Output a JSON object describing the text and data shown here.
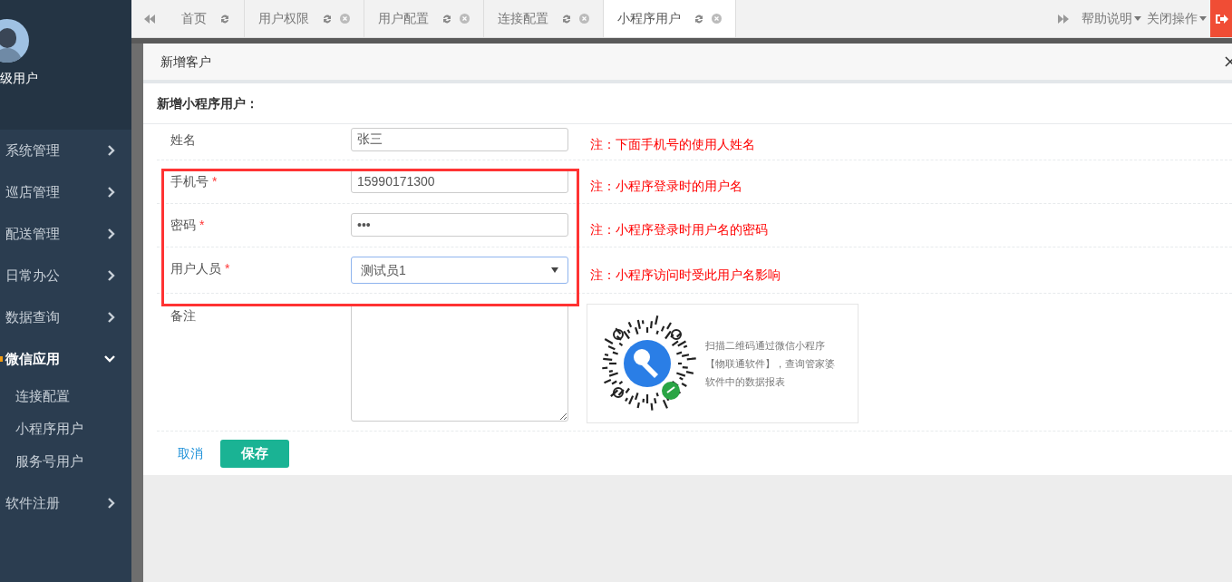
{
  "user": {
    "name": "级用户"
  },
  "sidebar": {
    "items": [
      {
        "label": "系统管理",
        "expanded": false
      },
      {
        "label": "巡店管理",
        "expanded": false
      },
      {
        "label": "配送管理",
        "expanded": false
      },
      {
        "label": "日常办公",
        "expanded": false
      },
      {
        "label": "数据查询",
        "expanded": false
      },
      {
        "label": "微信应用",
        "expanded": true,
        "children": [
          {
            "label": "连接配置"
          },
          {
            "label": "小程序用户"
          },
          {
            "label": "服务号用户"
          }
        ]
      },
      {
        "label": "软件注册",
        "expanded": false
      }
    ]
  },
  "tabs": [
    {
      "label": "首页",
      "closable": false,
      "selected": false
    },
    {
      "label": "用户权限",
      "closable": true,
      "selected": false
    },
    {
      "label": "用户配置",
      "closable": true,
      "selected": false
    },
    {
      "label": "连接配置",
      "closable": true,
      "selected": false
    },
    {
      "label": "小程序用户",
      "closable": true,
      "selected": true
    }
  ],
  "tab_menus": [
    "帮助说明",
    "关闭操作"
  ],
  "dialog": {
    "title": "新增客户",
    "section_title": "新增小程序用户：",
    "fields": [
      {
        "kind": "text",
        "label": "姓名",
        "value": "张三",
        "note": "注：下面手机号的使用人姓名"
      },
      {
        "kind": "text",
        "label": "手机号",
        "required_mark": "*",
        "value": "15990171300",
        "note": "注：小程序登录时的用户名"
      },
      {
        "kind": "password",
        "label": "密码",
        "required_mark": "*",
        "value": "•••",
        "note": "注：小程序登录时用户名的密码"
      },
      {
        "kind": "select",
        "label": "用户人员",
        "required_mark": "*",
        "value": "测试员1",
        "note": "注：小程序访问时受此用户名影响"
      },
      {
        "kind": "textarea",
        "label": "备注"
      }
    ],
    "qr_text": "扫描二维码通过微信小程序【物联通软件】，查询管家婆软件中的数据报表",
    "cancel": "取消",
    "save": "保存"
  }
}
